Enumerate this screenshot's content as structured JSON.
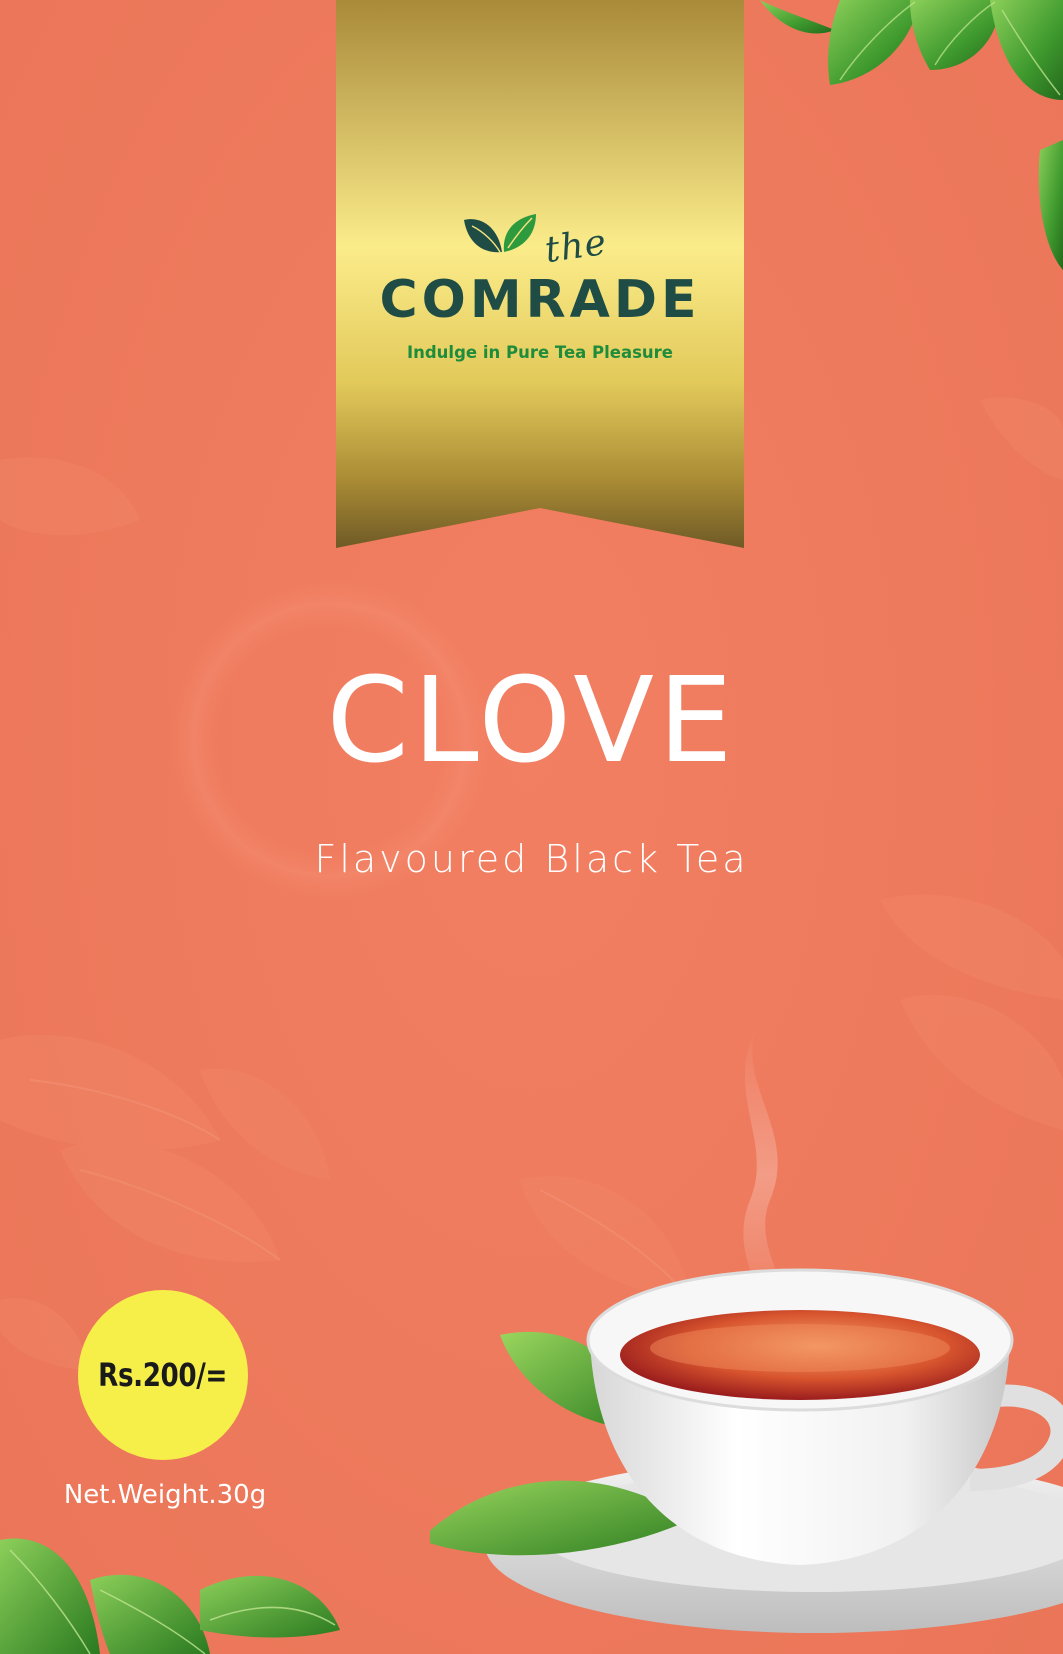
{
  "brand": {
    "prefix": "the",
    "name": "COMRADE",
    "tagline": "Indulge in Pure Tea Pleasure",
    "logo_icon": "tea-leaves-icon"
  },
  "product": {
    "name": "CLOVE",
    "subtitle": "Flavoured Black Tea"
  },
  "price": {
    "label": "Rs.200/="
  },
  "net_weight": "Net.Weight.30g",
  "colors": {
    "background": "#ee7a5d",
    "ribbon_gold": "#d8c25a",
    "brand_dark_green": "#1f4d45",
    "tagline_green": "#1f8c3c",
    "price_badge": "#f6ef4a",
    "text_white": "#ffffff"
  },
  "decorations": {
    "top_right": "green-tea-leaves-icon",
    "bottom_left": "green-tea-leaves-icon",
    "bottom_right": "tea-cup-icon"
  }
}
